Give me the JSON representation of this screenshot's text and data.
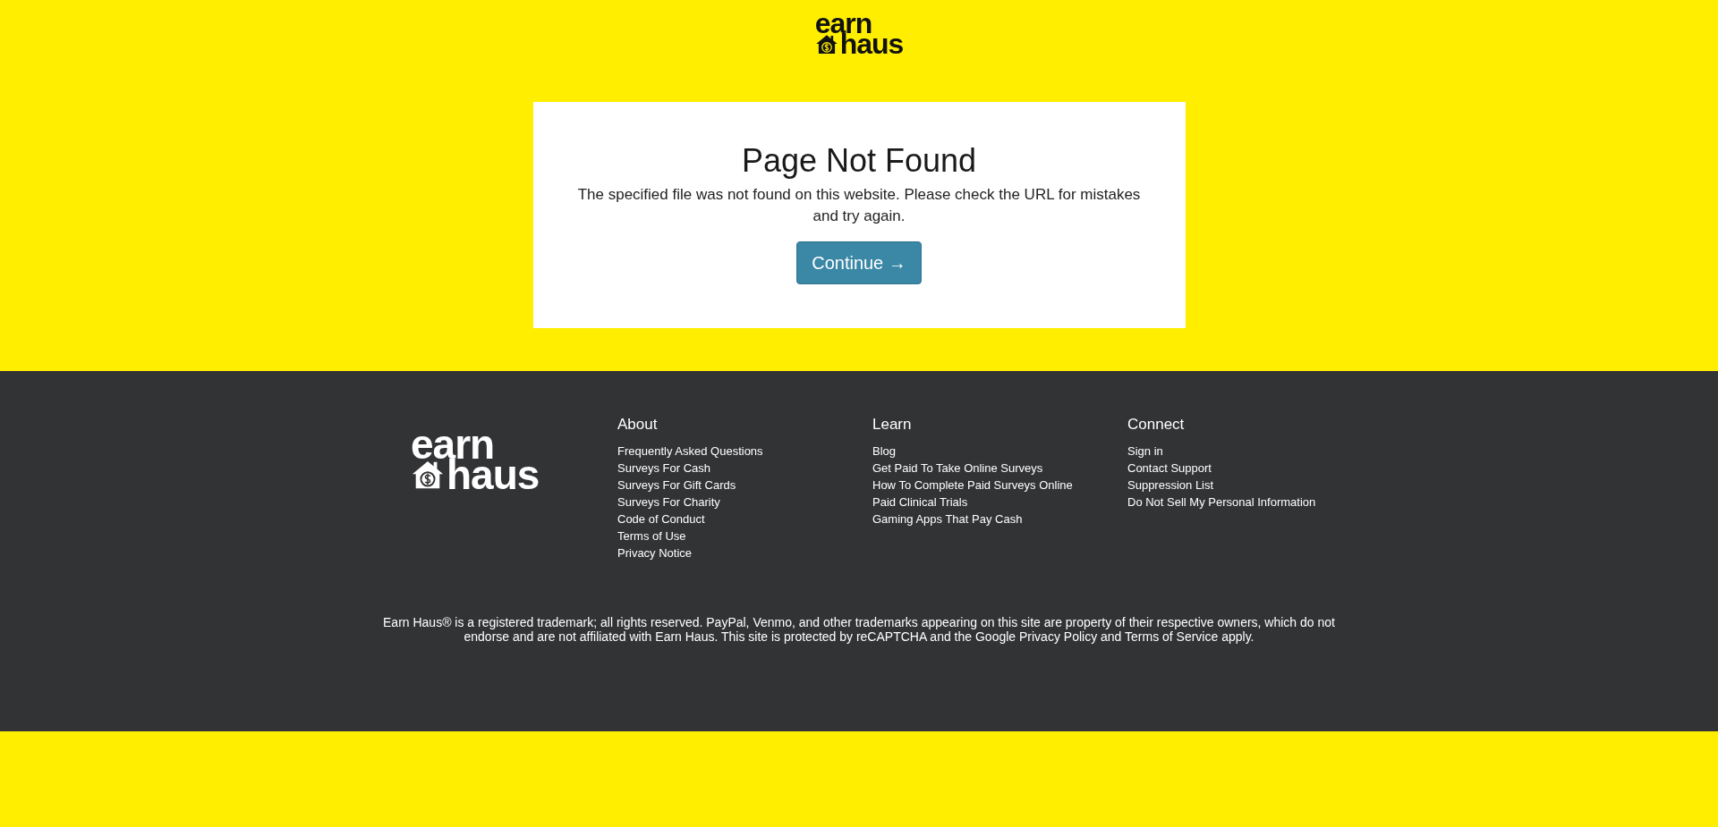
{
  "header": {
    "logo": {
      "line_1": "earn",
      "line_2": "haus"
    }
  },
  "error_card": {
    "title": "Page Not Found",
    "message": "The specified file was not found on this website. Please check the URL for mistakes and try again.",
    "button": "Continue →"
  },
  "footer": {
    "logo": {
      "line_1": "earn",
      "line_2": "haus"
    },
    "columns": [
      {
        "heading": "About",
        "links": [
          "Frequently Asked Questions",
          "Surveys For Cash",
          "Surveys For Gift Cards",
          "Surveys For Charity",
          "Code of Conduct",
          "Terms of Use",
          "Privacy Notice"
        ]
      },
      {
        "heading": "Learn",
        "links": [
          "Blog",
          "Get Paid To Take Online Surveys",
          "How To Complete Paid Surveys Online",
          "Paid Clinical Trials",
          "Gaming Apps That Pay Cash"
        ]
      },
      {
        "heading": "Connect",
        "links": [
          "Sign in",
          "Contact Support",
          "Suppression List",
          "Do Not Sell My Personal Information"
        ]
      }
    ],
    "disclaimer": "Earn Haus® is a registered trademark; all rights reserved. PayPal, Venmo, and other trademarks appearing on this site are property of their respective owners, which do not endorse and are not affiliated with Earn Haus. This site is protected by reCAPTCHA and the Google Privacy Policy and Terms of Service apply."
  }
}
